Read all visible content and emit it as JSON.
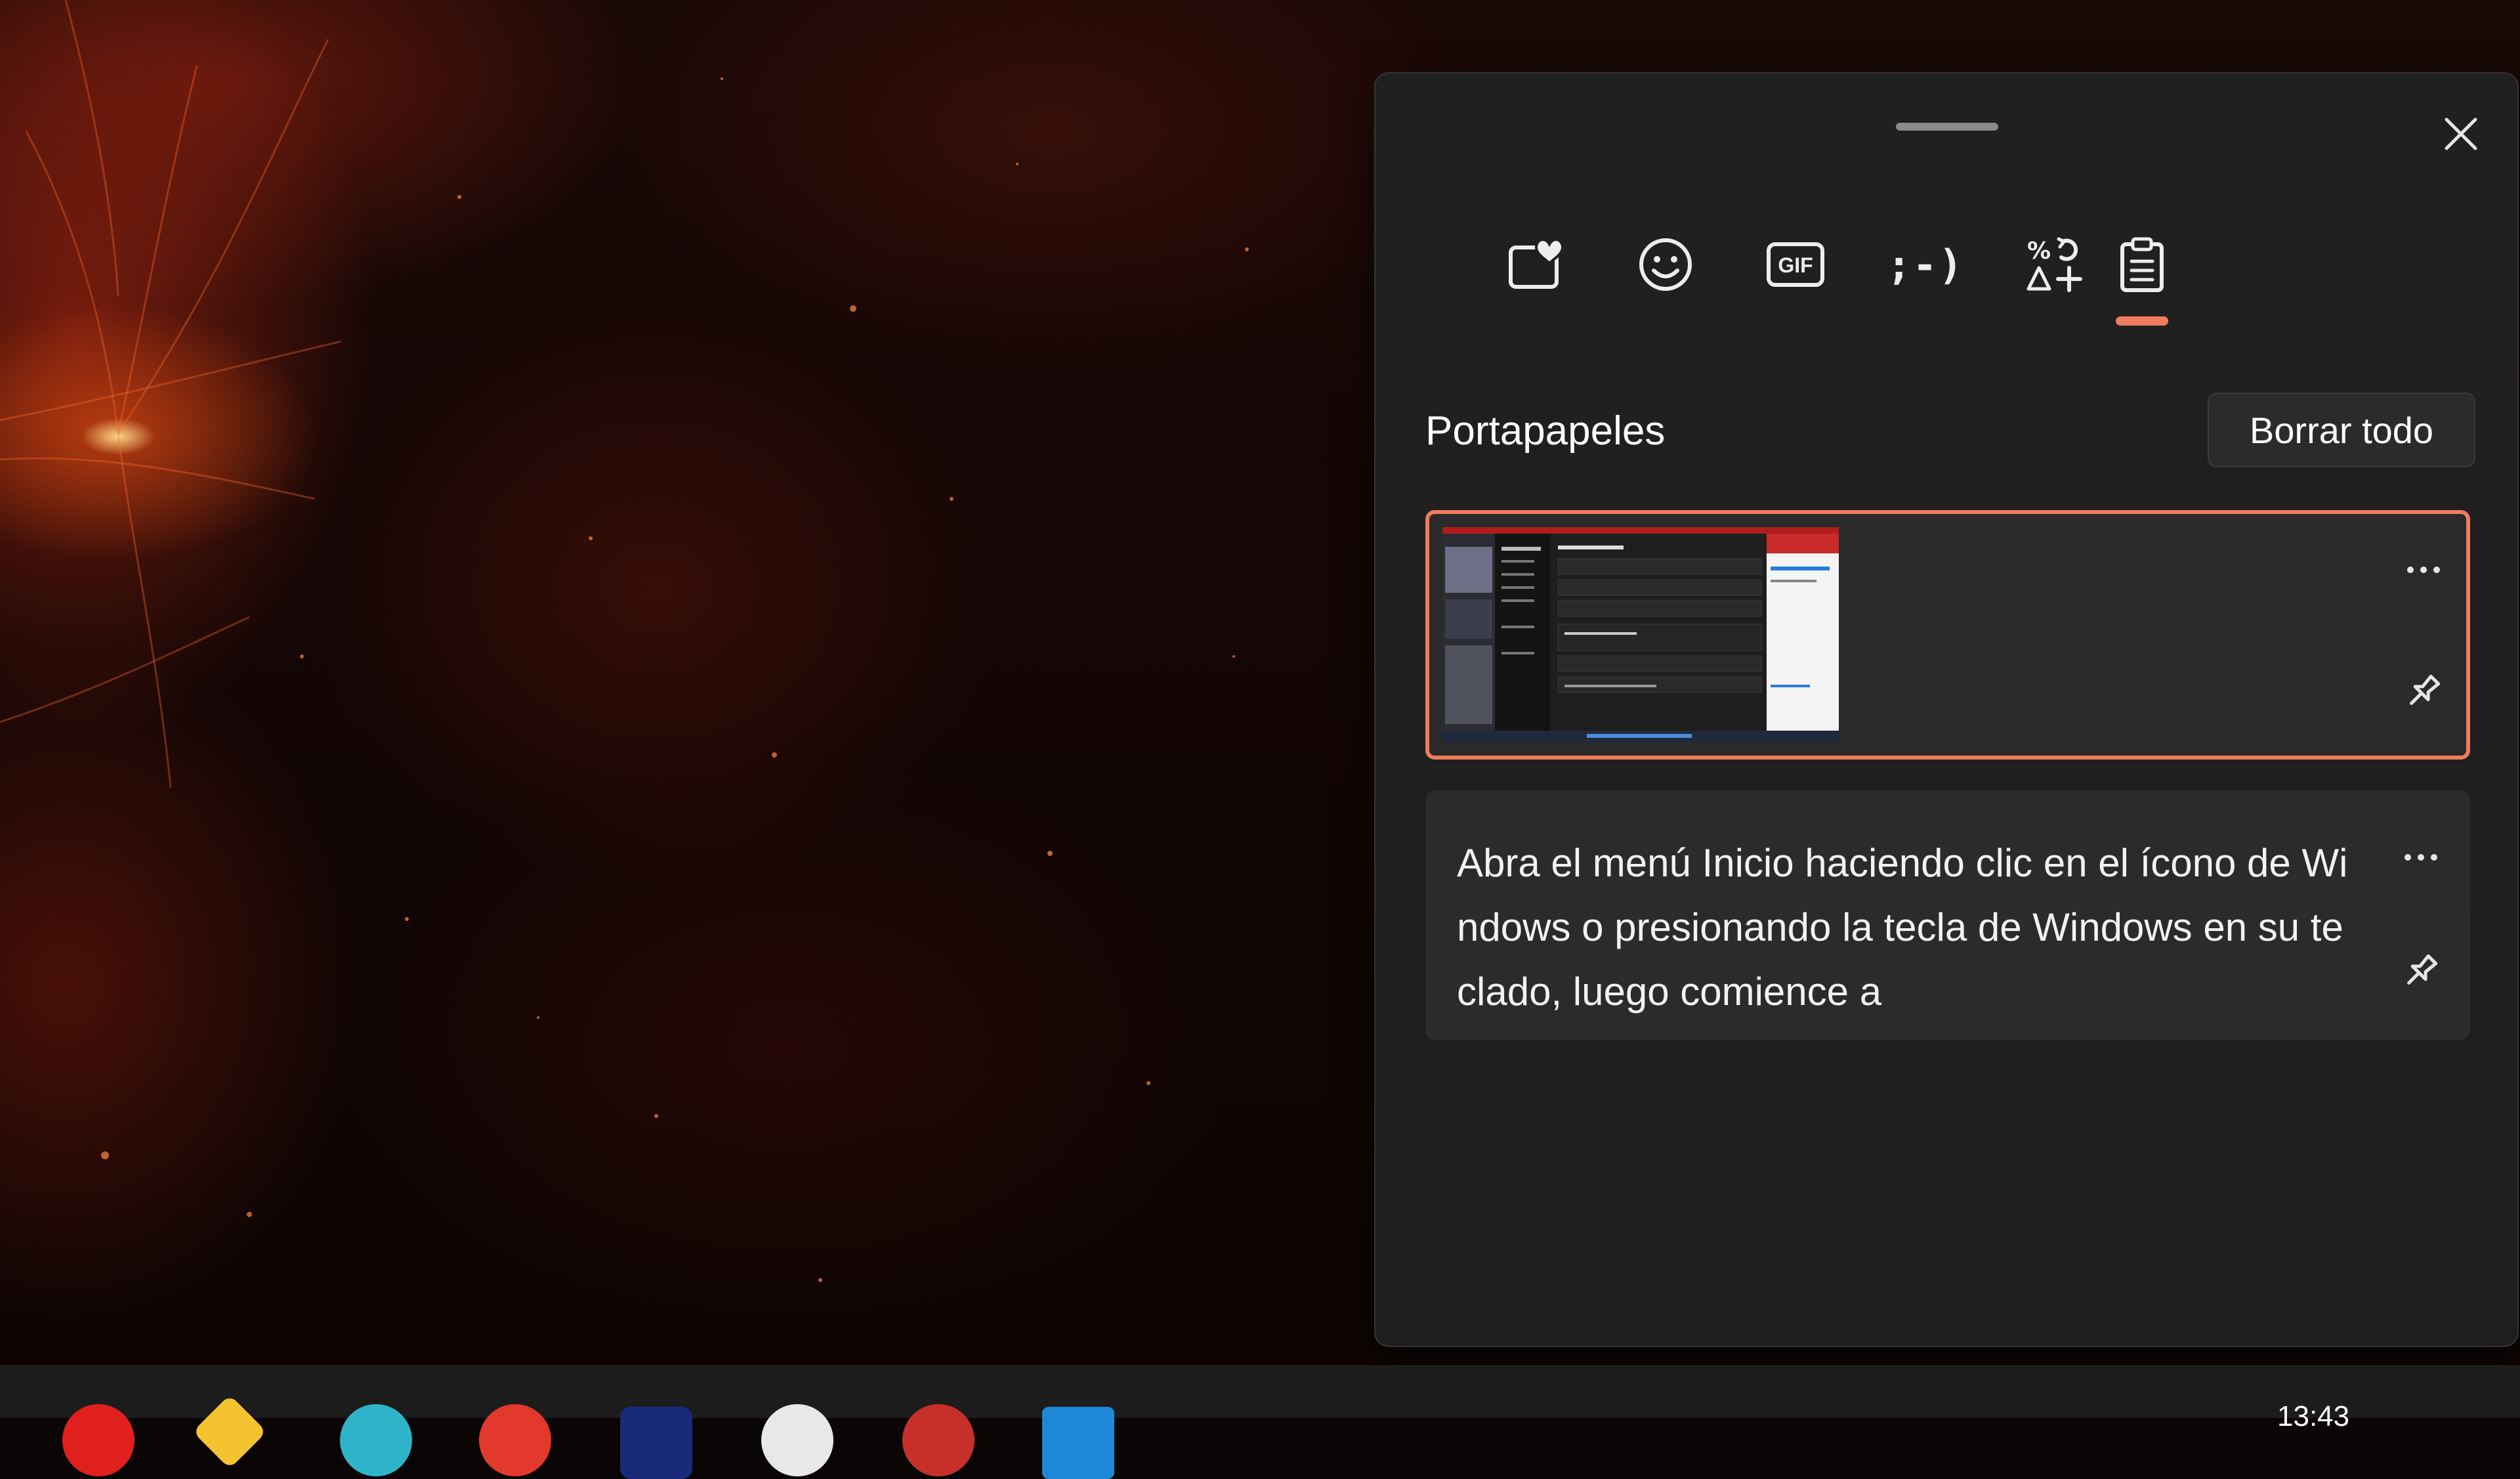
{
  "taskbar": {
    "clock": "13:43",
    "apps": [
      {
        "name": "opera-icon",
        "color": "#e0201c"
      },
      {
        "name": "file-explorer-icon",
        "color": "#f4c430"
      },
      {
        "name": "edge-icon",
        "color": "#2fb3c9"
      },
      {
        "name": "app-red-icon",
        "color": "#e2392c"
      },
      {
        "name": "app-navy-icon",
        "color": "#1a2a7a"
      },
      {
        "name": "app-white-icon",
        "color": "#e8e8e8"
      },
      {
        "name": "app-avatar-icon",
        "color": "#c7302a"
      },
      {
        "name": "app-blue-icon",
        "color": "#1e88d8"
      }
    ]
  },
  "panel": {
    "tabs": [
      {
        "name": "tab-favorites",
        "icon": "favorites-heart-icon"
      },
      {
        "name": "tab-emoji",
        "icon": "smiley-icon"
      },
      {
        "name": "tab-gif",
        "icon": "gif-icon"
      },
      {
        "name": "tab-kaomoji",
        "icon": "kaomoji-icon",
        "label": ";-)"
      },
      {
        "name": "tab-symbols",
        "icon": "symbols-icon"
      },
      {
        "name": "tab-clipboard",
        "icon": "clipboard-icon",
        "selected": true
      }
    ],
    "section_title": "Portapapeles",
    "clear_all_label": "Borrar todo",
    "accent_color": "#f07c5c",
    "items": [
      {
        "type": "image",
        "selected": true
      },
      {
        "type": "text",
        "text": "Abra el menú Inicio haciendo clic en el ícono de Windows o presionando la tecla de Windows en su teclado, luego comience a"
      }
    ]
  }
}
